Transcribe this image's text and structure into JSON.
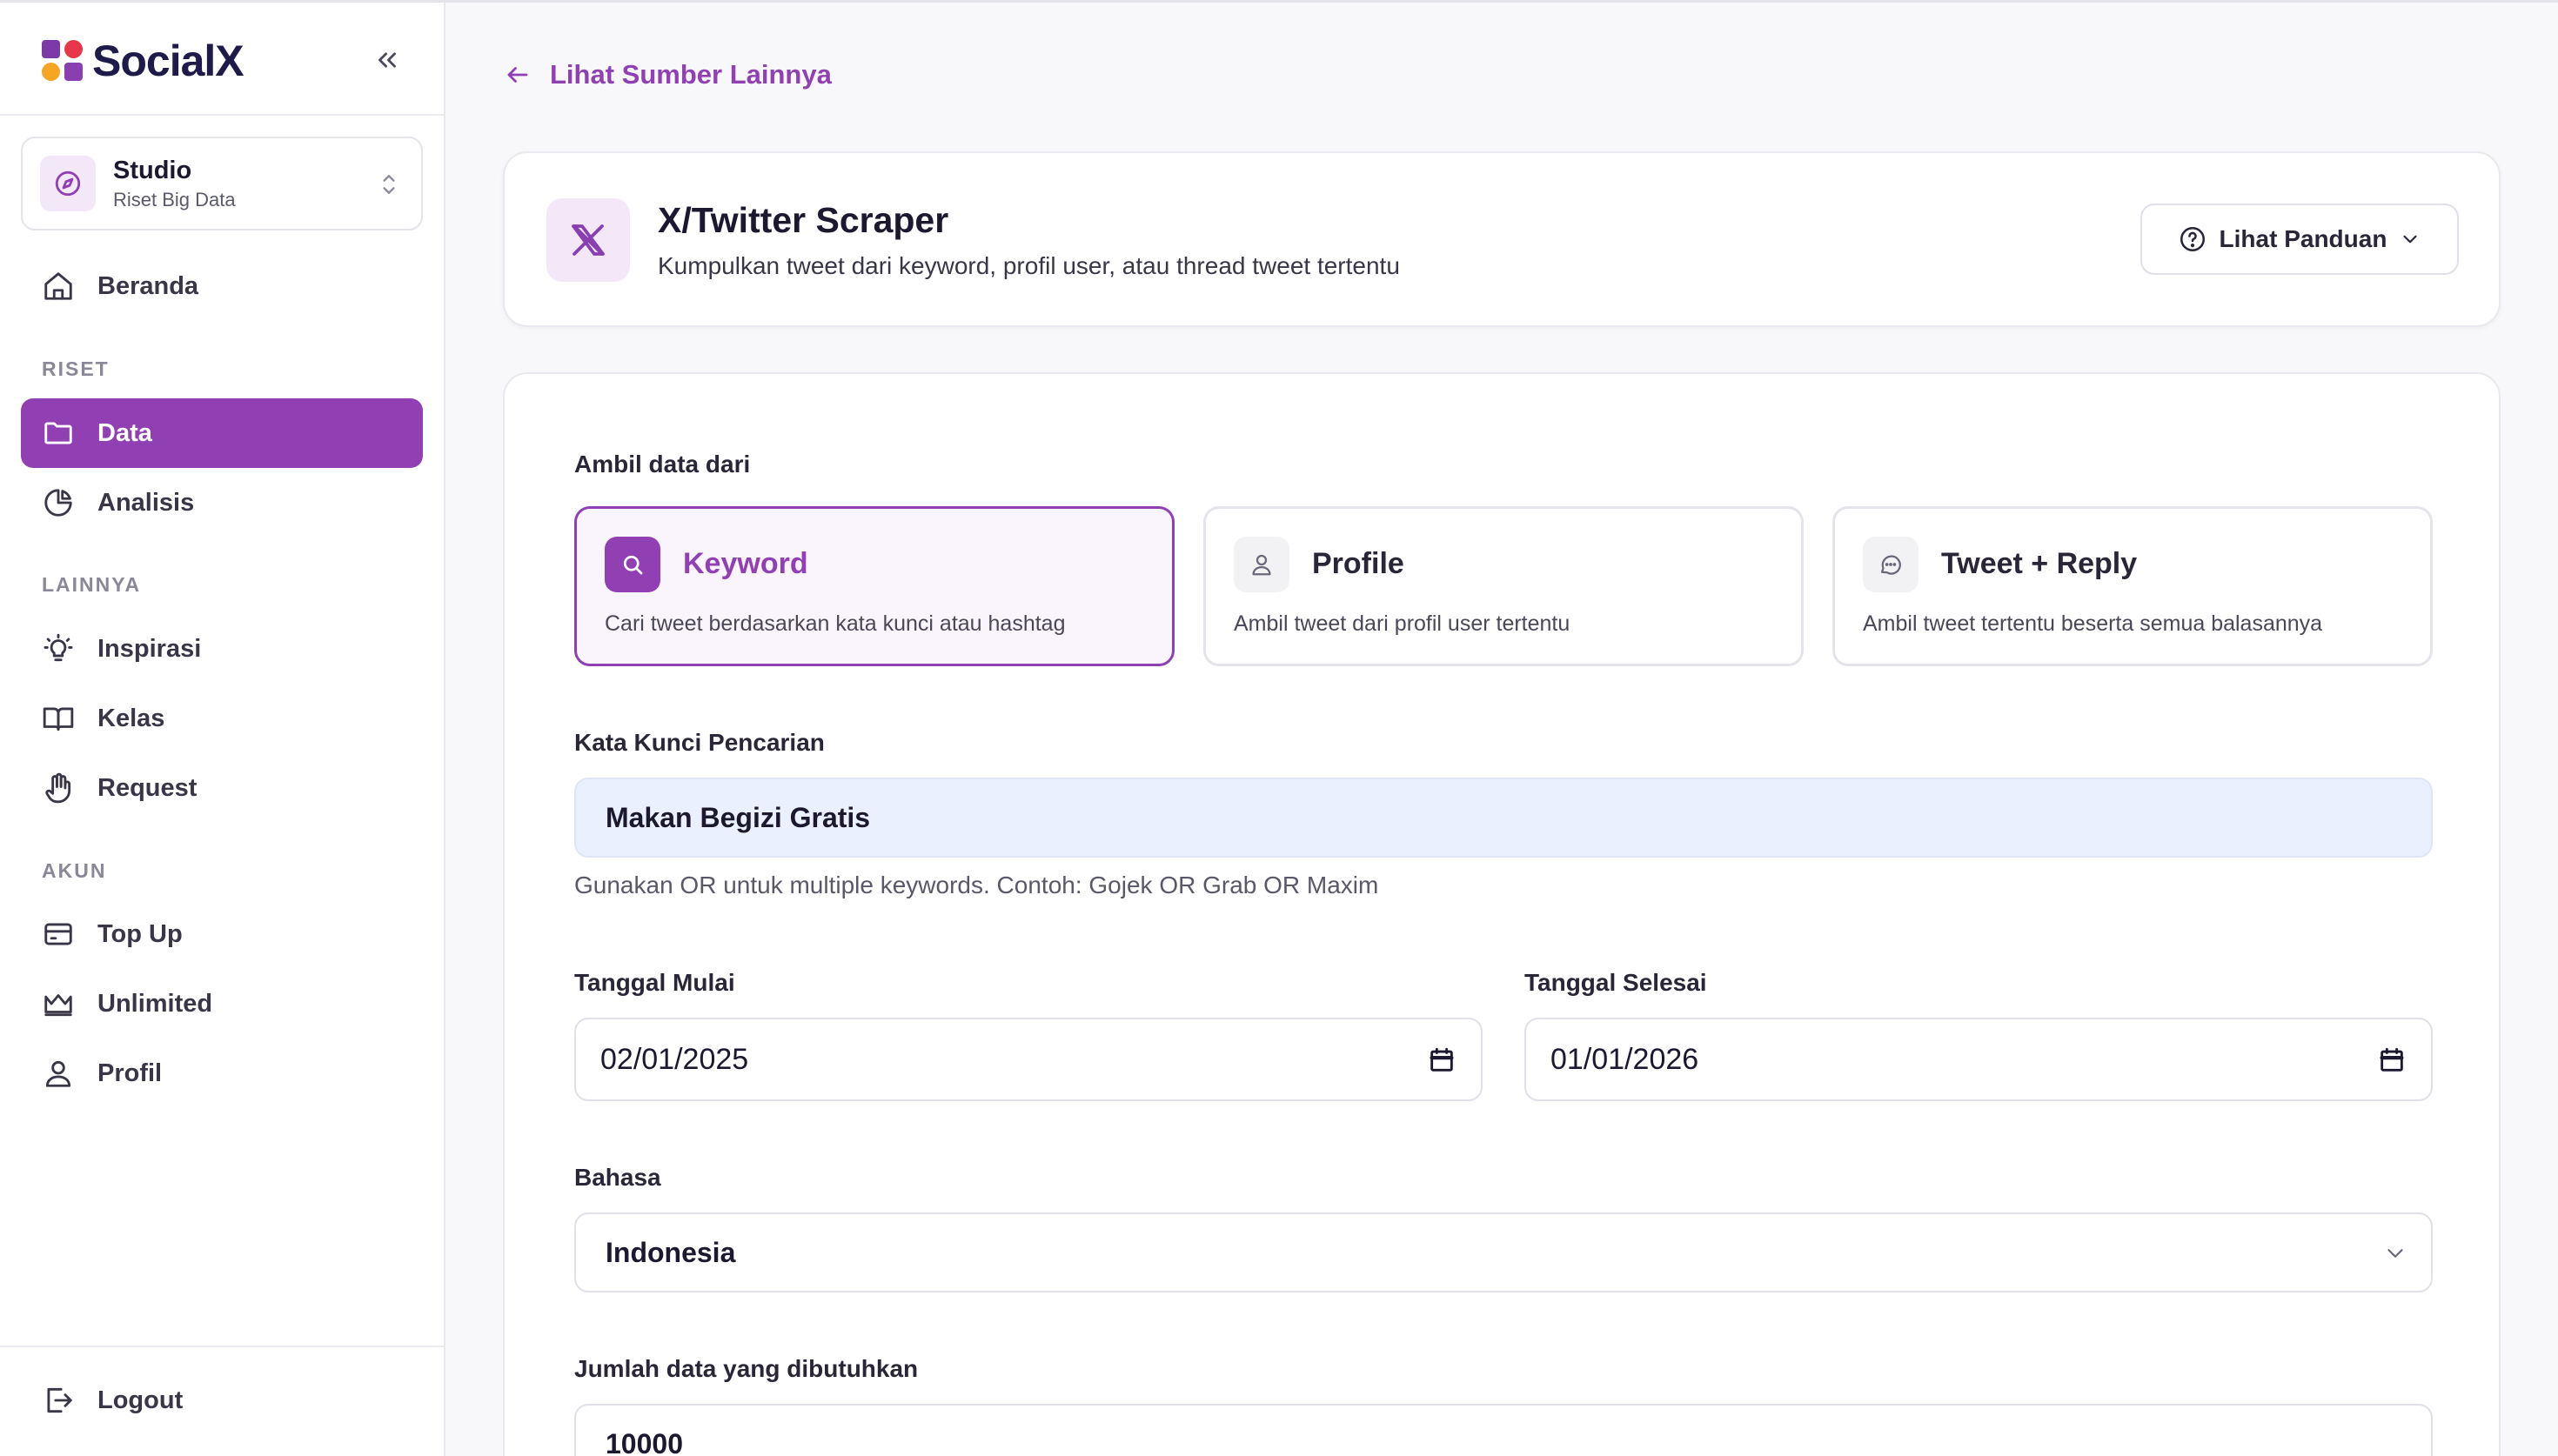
{
  "brand": {
    "name": "SocialX"
  },
  "workspace": {
    "title": "Studio",
    "subtitle": "Riset Big Data"
  },
  "sidebar": {
    "home": "Beranda",
    "section_riset": "RISET",
    "data": "Data",
    "analisis": "Analisis",
    "section_lainnya": "LAINNYA",
    "inspirasi": "Inspirasi",
    "kelas": "Kelas",
    "request": "Request",
    "section_akun": "AKUN",
    "topup": "Top Up",
    "unlimited": "Unlimited",
    "profil": "Profil",
    "logout": "Logout"
  },
  "back_link": "Lihat Sumber Lainnya",
  "header": {
    "title": "X/Twitter Scraper",
    "subtitle": "Kumpulkan tweet dari keyword, profil user, atau thread tweet tertentu",
    "guide_button": "Lihat Panduan"
  },
  "form": {
    "source_label": "Ambil data dari",
    "sources": [
      {
        "title": "Keyword",
        "desc": "Cari tweet berdasarkan kata kunci atau hashtag",
        "selected": true
      },
      {
        "title": "Profile",
        "desc": "Ambil tweet dari profil user tertentu",
        "selected": false
      },
      {
        "title": "Tweet + Reply",
        "desc": "Ambil tweet tertentu beserta semua balasannya",
        "selected": false
      }
    ],
    "keyword_label": "Kata Kunci Pencarian",
    "keyword_value": "Makan Begizi Gratis",
    "keyword_hint": "Gunakan OR untuk multiple keywords. Contoh: Gojek OR Grab OR Maxim",
    "start_label": "Tanggal Mulai",
    "start_value": "02/01/2025",
    "end_label": "Tanggal Selesai",
    "end_value": "01/01/2026",
    "language_label": "Bahasa",
    "language_value": "Indonesia",
    "amount_label": "Jumlah data yang dibutuhkan",
    "amount_value": "10000"
  },
  "colors": {
    "accent": "#9140b4",
    "input_bg": "#eaf0fd"
  }
}
